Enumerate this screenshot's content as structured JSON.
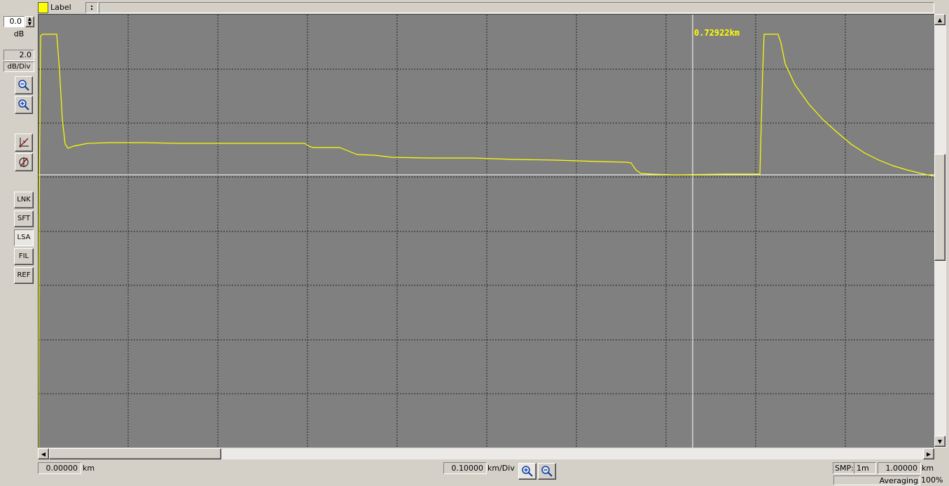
{
  "label_bar": {
    "swatch_color": "#ffff00",
    "label": "Label",
    "separator": ":",
    "value": ""
  },
  "left_panel": {
    "db_offset": "0.0",
    "db_unit": "dB",
    "db_per_div_value": "2.0",
    "db_per_div_unit": "dB/Div",
    "icons": [
      "zoom-out-icon",
      "zoom-in-icon",
      "auto-scale-icon",
      "cursor-reset-icon"
    ],
    "buttons": [
      "LNK",
      "SFT",
      "LSA",
      "FIL",
      "REF"
    ],
    "active_button": "LSA"
  },
  "plot": {
    "background": "#808080",
    "trace_color": "#ffff00",
    "grid_color": "#222222",
    "cursor_label": "0.72922km"
  },
  "bottom_bar": {
    "start_value": "0.00000",
    "start_unit": "km",
    "scale_value": "0.10000",
    "scale_unit": "km/Div",
    "smp_label": "SMP:",
    "smp_value": "1m",
    "range_value": "1.00000",
    "range_unit": "km",
    "averaging_label": "Averaging",
    "averaging_value": "100%"
  }
}
